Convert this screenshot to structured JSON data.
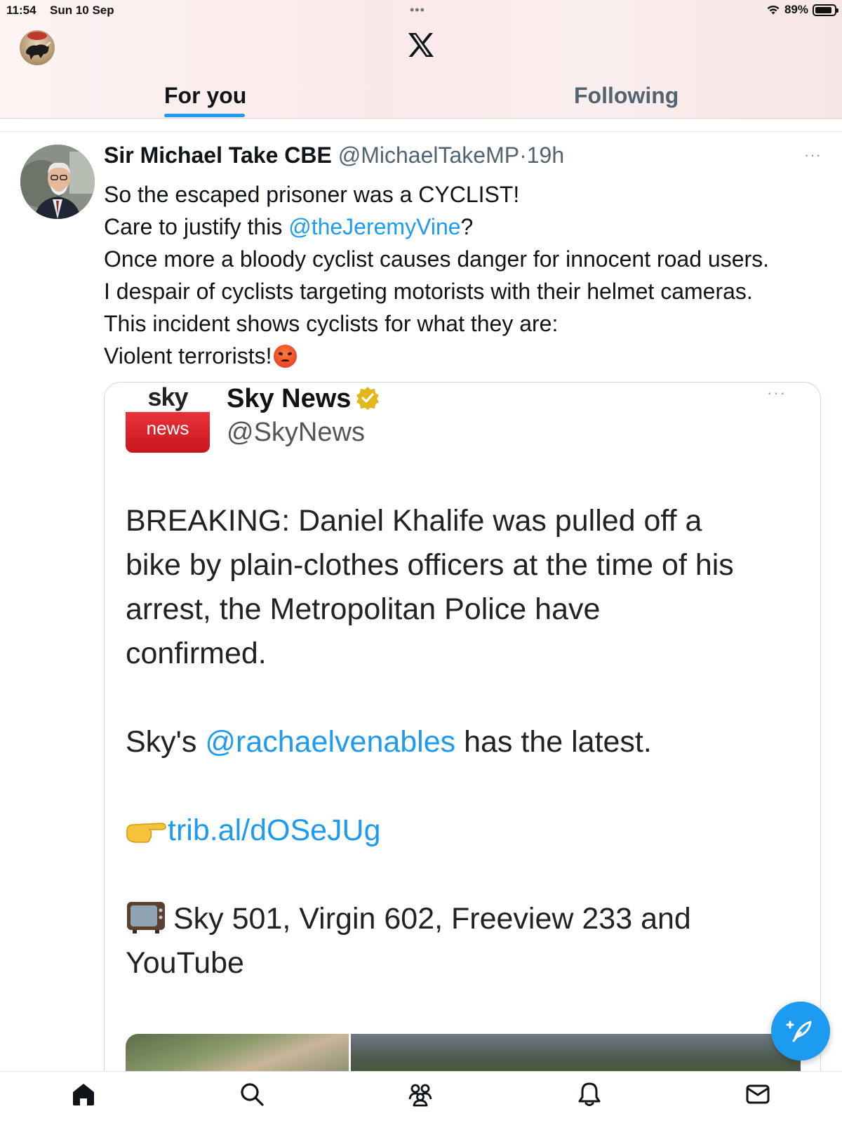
{
  "status_bar": {
    "time": "11:54",
    "date": "Sun 10 Sep",
    "battery": "89%",
    "battery_level": 0.89
  },
  "header": {
    "logo": "x-logo"
  },
  "tabs": [
    {
      "label": "For you",
      "active": true
    },
    {
      "label": "Following",
      "active": false
    }
  ],
  "tweet": {
    "name": "Sir Michael Take CBE",
    "handle": "@MichaelTakeMP",
    "separator": "·",
    "time": "19h",
    "more": "···",
    "lines": {
      "l1": "So the escaped prisoner was a CYCLIST!",
      "l2_pre": "Care to justify this ",
      "l2_mention": "@theJeremyVine",
      "l2_post": "?",
      "l3": "Once more a bloody cyclist causes danger for innocent road users.",
      "l4": "I despair of cyclists targeting motorists with their helmet cameras.",
      "l5": "This incident shows cyclists for what they are:",
      "l6": "Violent terrorists!"
    }
  },
  "embedded_screenshot": {
    "logo_top": "sky",
    "logo_bottom": "news",
    "name": "Sky News",
    "handle": "@SkyNews",
    "more": "···",
    "body": {
      "p1_l1": "BREAKING: Daniel Khalife was pulled off a",
      "p1_l2": "bike by plain-clothes officers at the time of his",
      "p1_l3": "arrest, the Metropolitan Police have",
      "p1_l4": "confirmed.",
      "p2_pre": "Sky's ",
      "p2_mention": "@rachaelvenables",
      "p2_post": " has the latest.",
      "link": "trib.al/dOSeJUg",
      "p4_l1": "Sky 501, Virgin 602, Freeview 233 and",
      "p4_l2": "YouTube"
    }
  },
  "colors": {
    "accent": "#1d9bf0",
    "sky_red": "#d7232b",
    "verified_gold": "#e2b719"
  },
  "bottom_nav": [
    "home-icon",
    "search-icon",
    "communities-icon",
    "notifications-icon",
    "messages-icon"
  ]
}
